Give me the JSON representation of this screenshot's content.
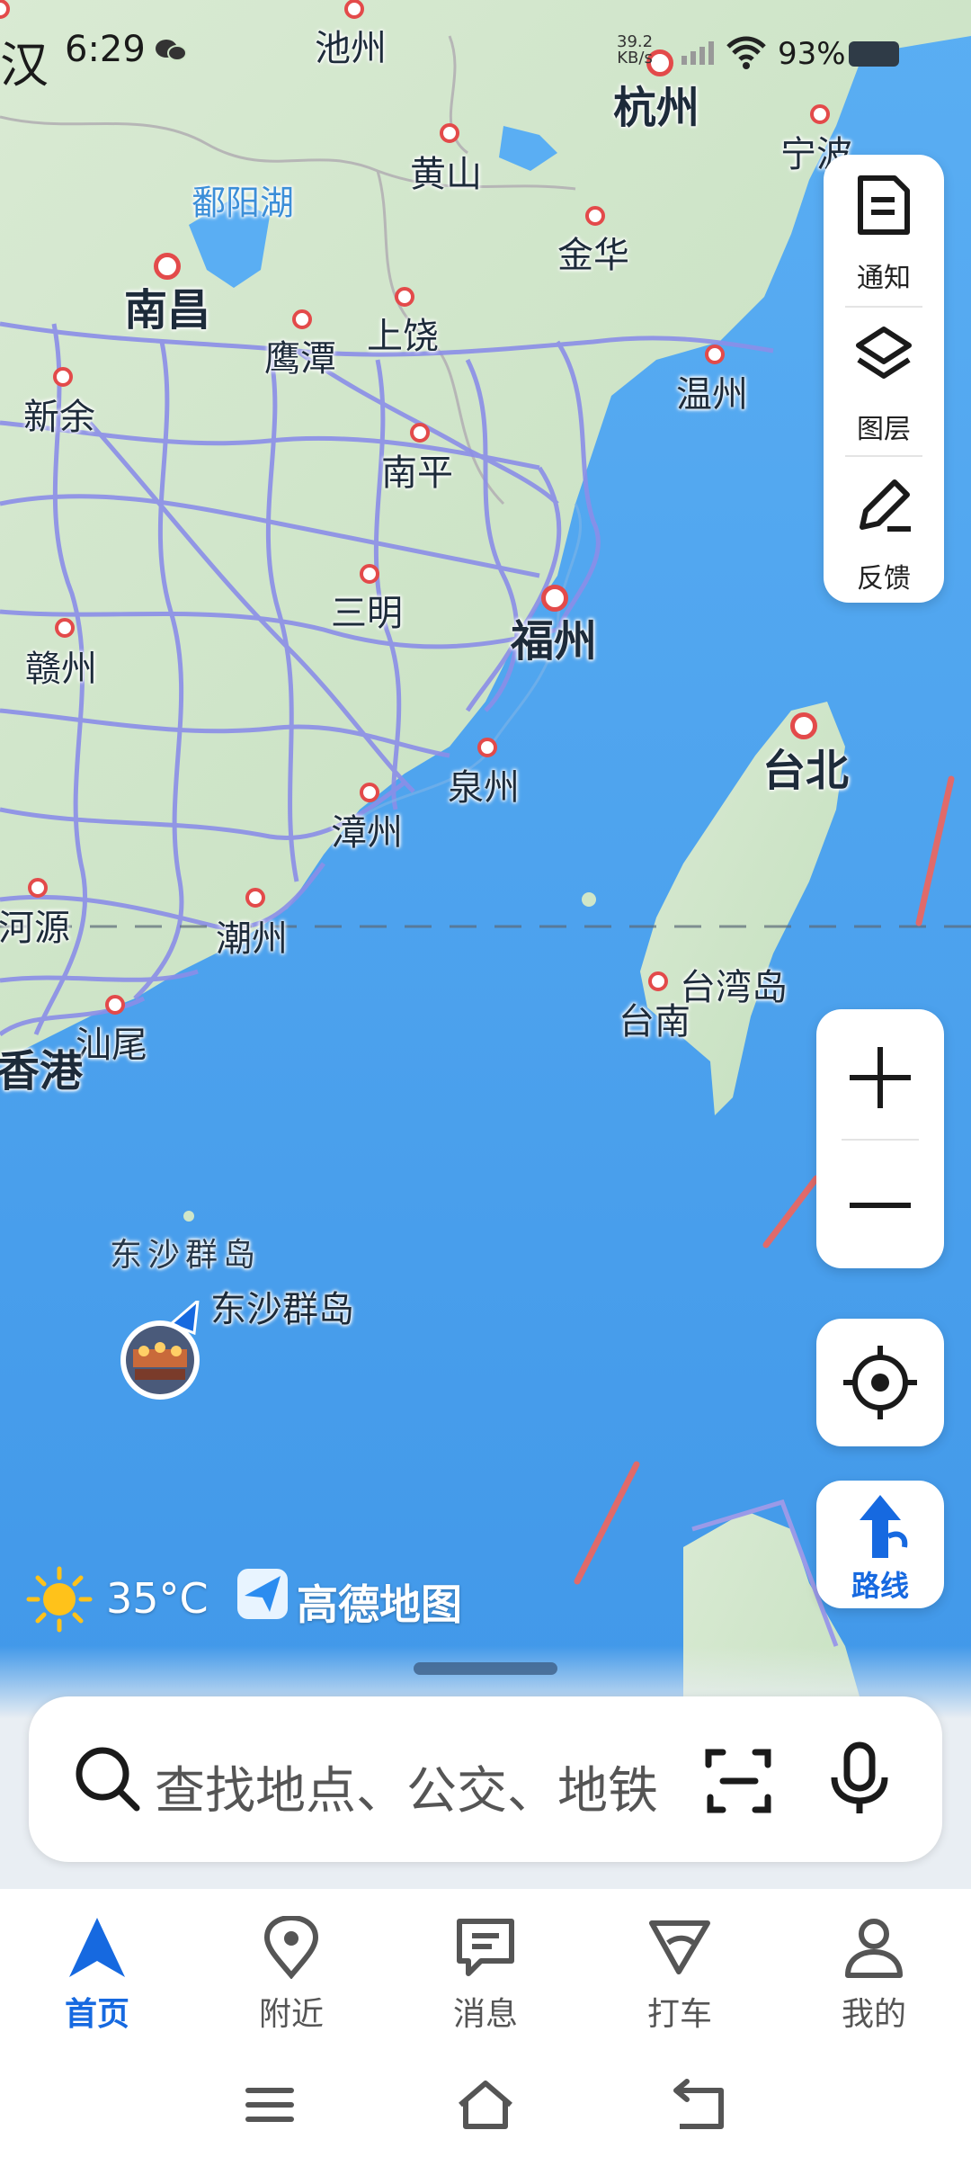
{
  "status_bar": {
    "partial_city": "汉",
    "time": "6:29",
    "net_speed_value": "39.2",
    "net_speed_unit": "KB/s",
    "battery": "93%"
  },
  "map": {
    "cities": [
      {
        "name": "池州",
        "size": "mid"
      },
      {
        "name": "杭州",
        "size": "big"
      },
      {
        "name": "宁波",
        "size": "mid"
      },
      {
        "name": "黄山",
        "size": "mid"
      },
      {
        "name": "鄱阳湖",
        "size": "water"
      },
      {
        "name": "金华",
        "size": "mid"
      },
      {
        "name": "南昌",
        "size": "big"
      },
      {
        "name": "上饶",
        "size": "mid"
      },
      {
        "name": "鹰潭",
        "size": "mid"
      },
      {
        "name": "温州",
        "size": "mid"
      },
      {
        "name": "新余",
        "size": "mid"
      },
      {
        "name": "南平",
        "size": "mid"
      },
      {
        "name": "三明",
        "size": "mid"
      },
      {
        "name": "福州",
        "size": "big"
      },
      {
        "name": "赣州",
        "size": "mid"
      },
      {
        "name": "台北",
        "size": "big"
      },
      {
        "name": "泉州",
        "size": "mid"
      },
      {
        "name": "漳州",
        "size": "mid"
      },
      {
        "name": "河源",
        "size": "mid"
      },
      {
        "name": "潮州",
        "size": "mid"
      },
      {
        "name": "台湾岛",
        "size": "mid"
      },
      {
        "name": "台南",
        "size": "mid"
      },
      {
        "name": "汕尾",
        "size": "mid"
      },
      {
        "name": "香港",
        "size": "big"
      },
      {
        "name": "东沙群岛",
        "size": "sea"
      },
      {
        "name": "东沙群岛",
        "size": "mid"
      }
    ]
  },
  "tools": {
    "notice": "通知",
    "layers": "图层",
    "feedback": "反馈"
  },
  "route_label": "路线",
  "weather": {
    "temperature": "35°C",
    "icon": "sun-icon"
  },
  "brand": {
    "name": "高德地图"
  },
  "search": {
    "placeholder": "查找地点、公交、地铁"
  },
  "bottom_nav": {
    "home": "首页",
    "nearby": "附近",
    "messages": "消息",
    "taxi": "打车",
    "mine": "我的"
  },
  "colors": {
    "accent": "#1669e0",
    "sea": "#4aa3f0",
    "land": "#cfe6c8",
    "road": "#8b8ee8",
    "city_dot": "#e34a4a"
  }
}
